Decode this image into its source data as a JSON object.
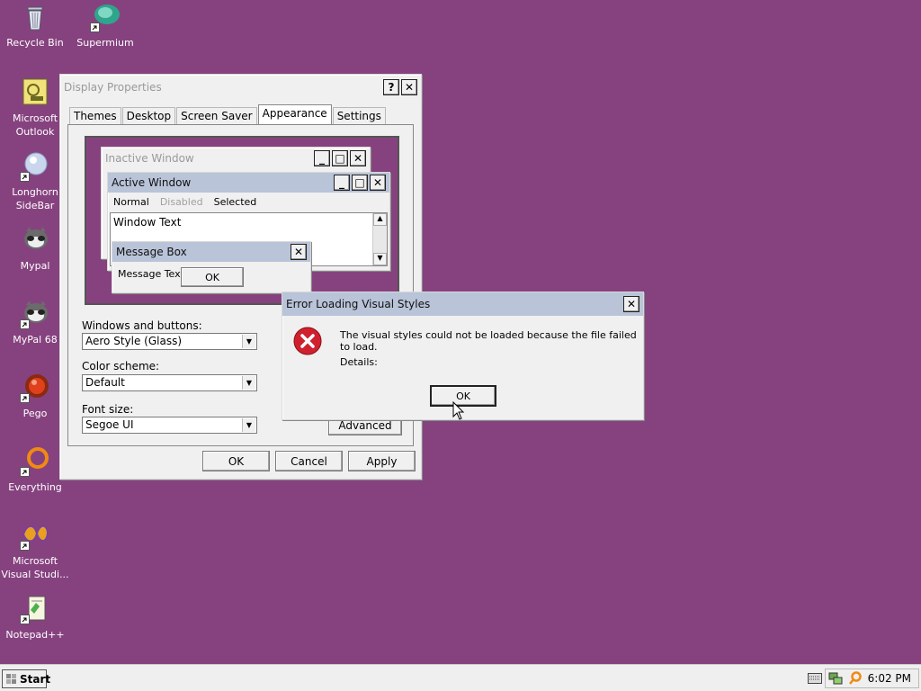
{
  "desktop": {
    "icons": [
      {
        "label": "Recycle Bin"
      },
      {
        "label": "Supermium"
      },
      {
        "label": "Microsoft Outlook"
      },
      {
        "label": "Longhorn SideBar"
      },
      {
        "label": "Mypal"
      },
      {
        "label": "MyPal 68"
      },
      {
        "label": "Pego"
      },
      {
        "label": "Everything"
      },
      {
        "label": "Microsoft Visual Studi..."
      },
      {
        "label": "Notepad++"
      }
    ]
  },
  "display_properties": {
    "title": "Display Properties",
    "help_button": "?",
    "close_button": "✕",
    "tabs": [
      "Themes",
      "Desktop",
      "Screen Saver",
      "Appearance",
      "Settings"
    ],
    "selected_tab": "Appearance",
    "preview": {
      "inactive_title": "Inactive Window",
      "active_title": "Active Window",
      "menu": {
        "normal": "Normal",
        "disabled": "Disabled",
        "selected": "Selected"
      },
      "window_text": "Window Text",
      "msgbox_title": "Message Box",
      "msgbox_text": "Message Text",
      "msgbox_ok": "OK"
    },
    "windows_buttons_label": "Windows and buttons:",
    "windows_buttons_value": "Aero Style (Glass)",
    "color_scheme_label": "Color scheme:",
    "color_scheme_value": "Default",
    "font_size_label": "Font size:",
    "font_size_value": "Segoe UI",
    "advanced_label": "Advanced",
    "ok_label": "OK",
    "cancel_label": "Cancel",
    "apply_label": "Apply"
  },
  "error_dialog": {
    "title": "Error Loading Visual Styles",
    "close_button": "✕",
    "message": "The visual styles could not be loaded because the file failed to load.",
    "details": "Details:",
    "ok_label": "OK"
  },
  "taskbar": {
    "start_label": "Start",
    "clock": "6:02 PM"
  },
  "colors": {
    "desktop": "#86427f",
    "active_title": "#b9c4d9",
    "error_icon": "#d0202e"
  }
}
